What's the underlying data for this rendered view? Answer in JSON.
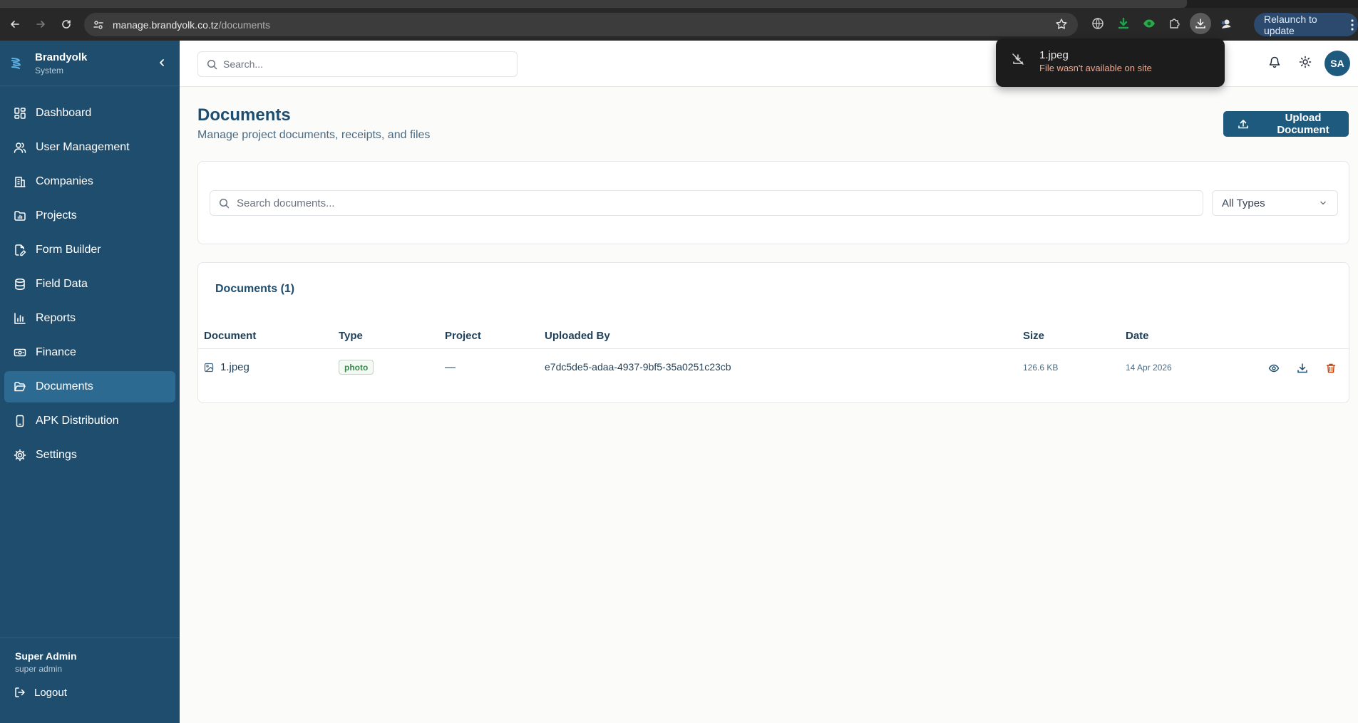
{
  "browser": {
    "url_host": "manage.brandyolk.co.tz",
    "url_path": "/documents",
    "relaunch_label": "Relaunch to update"
  },
  "download_popup": {
    "file_name": "1.jpeg",
    "status": "File wasn't available on site"
  },
  "sidebar": {
    "brand_name": "Brandyolk",
    "brand_sub": "System",
    "items": [
      {
        "label": "Dashboard",
        "icon": "dashboard-icon"
      },
      {
        "label": "User Management",
        "icon": "users-icon"
      },
      {
        "label": "Companies",
        "icon": "building-icon"
      },
      {
        "label": "Projects",
        "icon": "folder-chart-icon"
      },
      {
        "label": "Form Builder",
        "icon": "file-edit-icon"
      },
      {
        "label": "Field Data",
        "icon": "database-icon"
      },
      {
        "label": "Reports",
        "icon": "bar-chart-icon"
      },
      {
        "label": "Finance",
        "icon": "banknote-icon"
      },
      {
        "label": "Documents",
        "icon": "folder-open-icon",
        "active": true
      },
      {
        "label": "APK Distribution",
        "icon": "smartphone-icon"
      },
      {
        "label": "Settings",
        "icon": "gear-icon"
      }
    ],
    "user_name": "Super Admin",
    "user_role": "super admin",
    "logout_label": "Logout"
  },
  "header": {
    "search_placeholder": "Search...",
    "avatar_initials": "SA"
  },
  "page": {
    "title": "Documents",
    "subtitle": "Manage project documents, receipts, and files",
    "upload_label": "Upload Document"
  },
  "filters": {
    "search_placeholder": "Search documents...",
    "type_selected": "All Types"
  },
  "table": {
    "title": "Documents (1)",
    "columns": [
      "Document",
      "Type",
      "Project",
      "Uploaded By",
      "Size",
      "Date"
    ],
    "rows": [
      {
        "document": "1.jpeg",
        "type": "photo",
        "project": "—",
        "uploaded_by": "e7dc5de5-adaa-4937-9bf5-35a0251c23cb",
        "size": "126.6 KB",
        "date": "14 Apr 2026"
      }
    ]
  },
  "colors": {
    "sidebar_bg": "#1e4d6e",
    "sidebar_active": "#2d6a91",
    "primary": "#1e5a7e",
    "delete": "#c2410c",
    "badge_green": "#3b8a4c"
  }
}
